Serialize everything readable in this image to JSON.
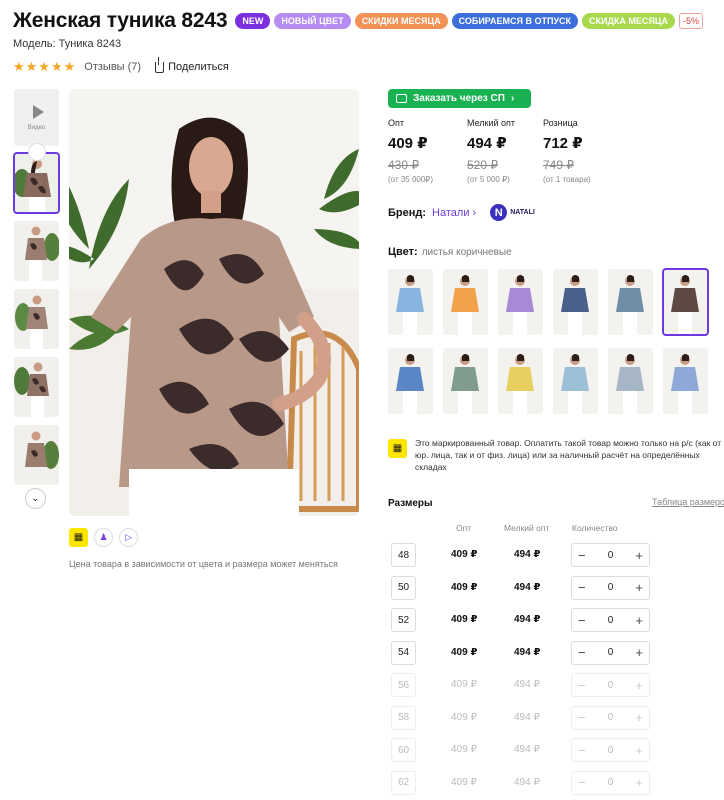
{
  "product": {
    "title": "Женская туника 8243",
    "model": "Модель: Туника 8243",
    "badges": [
      "NEW",
      "НОВЫЙ ЦВЕТ",
      "СКИДКИ МЕСЯЦА",
      "СОБИРАЕМСЯ В ОТПУСК",
      "СКИДКА МЕСЯЦА",
      "-5%"
    ],
    "stars": "★★★★★",
    "reviews": "Отзывы (7)",
    "share": "Поделиться"
  },
  "gallery": {
    "video_label": "Видео",
    "price_note": "Цена товара в зависимости от цвета и размера может меняться"
  },
  "order_button": "Заказать через СП",
  "prices": [
    {
      "label": "Опт",
      "value": "409 ₽",
      "old": "430 ₽",
      "min": "(от 35 000₽)"
    },
    {
      "label": "Мелкий опт",
      "value": "494 ₽",
      "old": "520 ₽",
      "min": "(от 5 000 ₽)"
    },
    {
      "label": "Розница",
      "value": "712 ₽",
      "old": "749 ₽",
      "min": "(от 1 товара)"
    }
  ],
  "brand": {
    "label": "Бренд:",
    "name": "Натали",
    "logo_text": "NATALI"
  },
  "color": {
    "label": "Цвет:",
    "value": "листья коричневые"
  },
  "swatch_colors": [
    "#8ab4e0",
    "#f2a24a",
    "#a98ad6",
    "#4a5f8c",
    "#6f8fa8",
    "#5e4a44",
    "#5a86c8",
    "#7f9c8c",
    "#e8d060",
    "#9cc0d8",
    "#a7b6c6",
    "#8fa8d8"
  ],
  "marked_text": "Это маркированный товар. Оплатить такой товар можно только на р/с (как от юр. лица, так и от физ. лица) или за наличный расчёт на определённых складах",
  "sizes": {
    "title": "Размеры",
    "table_link": "Таблица размеров",
    "headers": {
      "opt": "Опт",
      "small": "Мелкий опт",
      "qty": "Количество"
    },
    "rows": [
      {
        "size": "48",
        "opt": "409 ₽",
        "small": "494 ₽",
        "qty": "0",
        "available": true
      },
      {
        "size": "50",
        "opt": "409 ₽",
        "small": "494 ₽",
        "qty": "0",
        "available": true
      },
      {
        "size": "52",
        "opt": "409 ₽",
        "small": "494 ₽",
        "qty": "0",
        "available": true
      },
      {
        "size": "54",
        "opt": "409 ₽",
        "small": "494 ₽",
        "qty": "0",
        "available": true
      },
      {
        "size": "56",
        "opt": "409 ₽",
        "small": "494 ₽",
        "qty": "0",
        "available": false
      },
      {
        "size": "58",
        "opt": "409 ₽",
        "small": "494 ₽",
        "qty": "0",
        "available": false
      },
      {
        "size": "60",
        "opt": "409 ₽",
        "small": "494 ₽",
        "qty": "0",
        "available": false
      },
      {
        "size": "62",
        "opt": "409 ₽",
        "small": "494 ₽",
        "qty": "0",
        "available": false
      }
    ]
  },
  "colors": {
    "accent": "#6c3ae0",
    "green": "#19b253",
    "star": "#f6a623"
  }
}
